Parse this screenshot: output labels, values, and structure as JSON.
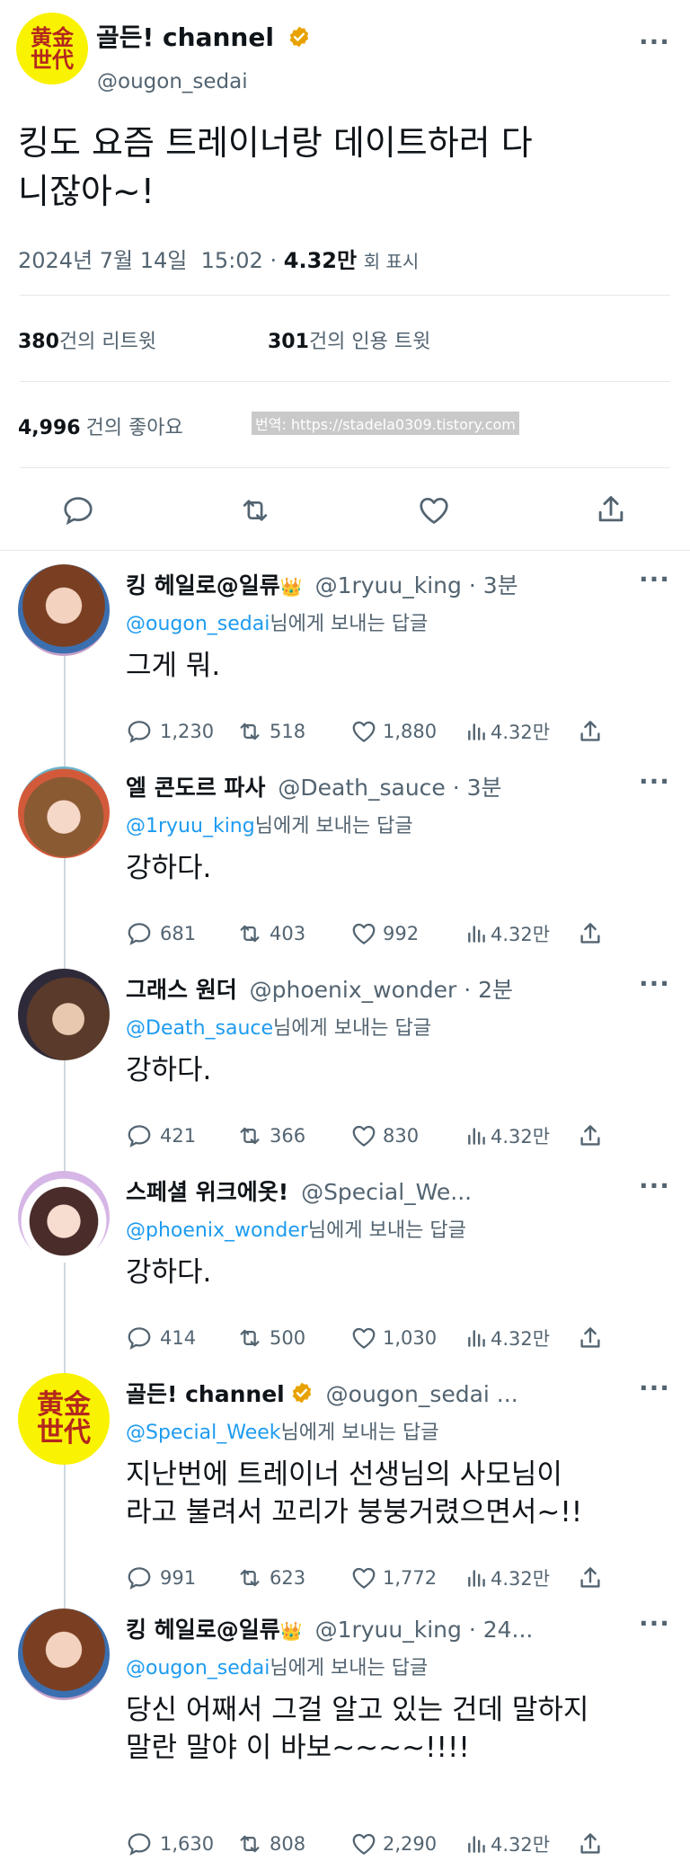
{
  "main_tweet": {
    "avatar_text": [
      "黄金",
      "世代"
    ],
    "display_name": "골든! channel",
    "handle": "@ougon_sedai",
    "text_line1": "킹도 요즘 트레이너랑 데이트하러 다",
    "text_line2": "니잖아~!",
    "date": "2024년 7월 14일",
    "time": "15:02",
    "separator": "·",
    "views": "4.32만",
    "views_label": "회 표시",
    "retweets": "380",
    "retweets_label": "건의 리트윗",
    "quotes": "301",
    "quotes_label": "건의 인용 트윗",
    "likes": "4,996",
    "likes_label": "건의 좋아요",
    "watermark": "번역: https://stadela0309.tistory.com"
  },
  "replies": [
    {
      "avatar": "anime-brown",
      "display_name": "킹 헤일로@일류",
      "crown": "👑",
      "handle_time": "@1ryuu_king · 3분",
      "reply_to": "@ougon_sedai",
      "reply_suffix": "님에게 보내는 답글",
      "text": [
        "그게 뭐."
      ],
      "comments": "1,230",
      "retweets": "518",
      "likes": "1,880",
      "views": "4.32만"
    },
    {
      "avatar": "anime-glasses",
      "display_name": "엘 콘도르 파사",
      "crown": "",
      "handle_time": "@Death_sauce · 3분",
      "reply_to": "@1ryuu_king",
      "reply_suffix": "님에게 보내는 답글",
      "text": [
        "강하다."
      ],
      "comments": "681",
      "retweets": "403",
      "likes": "992",
      "views": "4.32만"
    },
    {
      "avatar": "anime-dark",
      "display_name": "그래스 원더",
      "crown": "",
      "handle_time": "@phoenix_wonder · 2분",
      "reply_to": "@Death_sauce",
      "reply_suffix": "님에게 보내는 답글",
      "text": [
        "강하다."
      ],
      "comments": "421",
      "retweets": "366",
      "likes": "830",
      "views": "4.32만"
    },
    {
      "avatar": "anime-white",
      "display_name": "스페셜 위크에옷!",
      "crown": "",
      "handle_time": "@Special_We...",
      "reply_to": "@phoenix_wonder",
      "reply_suffix": "님에게 보내는 답글",
      "text": [
        "강하다."
      ],
      "comments": "414",
      "retweets": "500",
      "likes": "1,030",
      "views": "4.32만"
    },
    {
      "avatar": "gold",
      "display_name": "골든! channel",
      "crown": "",
      "handle_time": "@ougon_sedai ...",
      "reply_to": "@Special_Week",
      "reply_suffix": "님에게 보내는 답글",
      "text": [
        "지난번에 트레이너 선생님의 사모님이",
        "라고 불려서 꼬리가 붕붕거렸으면서~!!"
      ],
      "comments": "991",
      "retweets": "623",
      "likes": "1,772",
      "views": "4.32만"
    },
    {
      "avatar": "anime-brown",
      "display_name": "킹 헤일로@일류",
      "crown": "👑",
      "handle_time": "@1ryuu_king · 24...",
      "reply_to": "@ougon_sedai",
      "reply_suffix": "님에게 보내는 답글",
      "text": [
        "당신 어째서 그걸 알고 있는 건데 말하지",
        "말란 말야 이 바보~~~~!!!!"
      ],
      "comments": "1,630",
      "retweets": "808",
      "likes": "2,290",
      "views": "4.32만"
    }
  ],
  "colors": {
    "accent": "#1d9bf0",
    "gold_avatar": "#f9f200",
    "verified": "#e8a200"
  }
}
